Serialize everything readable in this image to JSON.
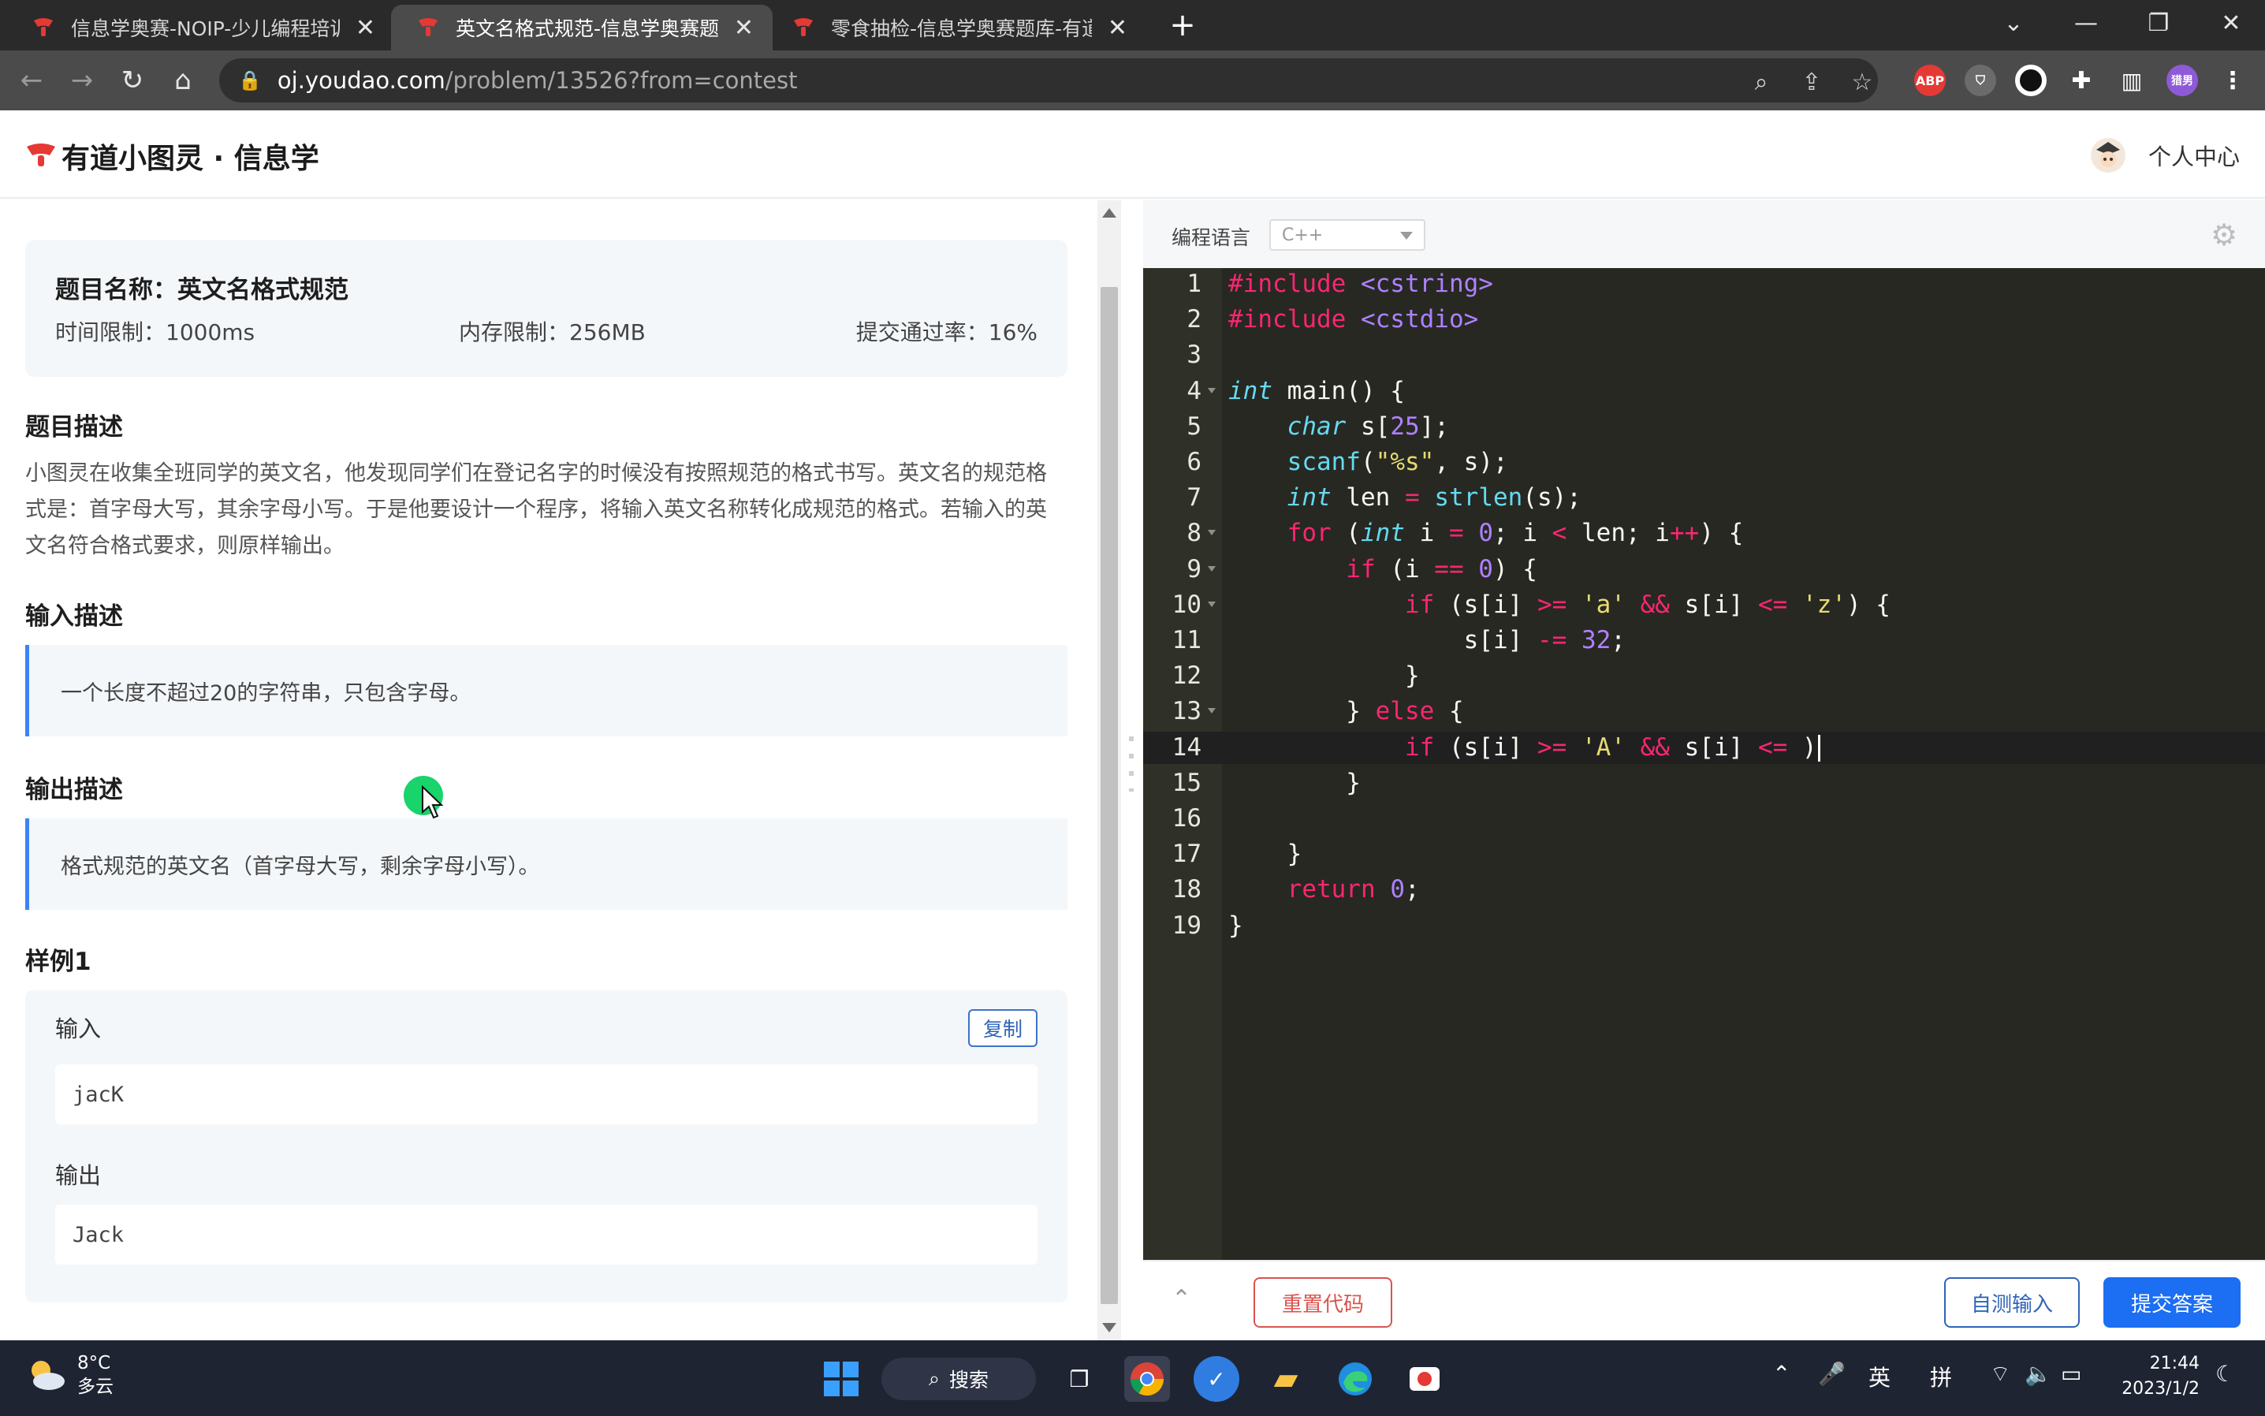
{
  "browser": {
    "tabs": [
      {
        "title": "信息学奥赛-NOIP-少儿编程培训",
        "active": false
      },
      {
        "title": "英文名格式规范-信息学奥赛题库",
        "active": true
      },
      {
        "title": "零食抽检-信息学奥赛题库-有道小",
        "active": false
      }
    ],
    "url_host": "oj.youdao.com",
    "url_path": "/problem/13526?from=contest",
    "profile_initials": "猎男",
    "ext_abp": "ABP"
  },
  "site": {
    "brand": "有道小图灵 · 信息学",
    "user_center": "个人中心"
  },
  "problem": {
    "name_label": "题目名称：英文名格式规范",
    "time_limit": "时间限制：1000ms",
    "memory_limit": "内存限制：256MB",
    "pass_rate": "提交通过率：16%",
    "desc_title": "题目描述",
    "desc_text": "小图灵在收集全班同学的英文名，他发现同学们在登记名字的时候没有按照规范的格式书写。英文名的规范格式是：首字母大写，其余字母小写。于是他要设计一个程序，将输入英文名称转化成规范的格式。若输入的英文名符合格式要求，则原样输出。",
    "input_title": "输入描述",
    "input_text": "一个长度不超过20的字符串，只包含字母。",
    "output_title": "输出描述",
    "output_text": "格式规范的英文名（首字母大写，剩余字母小写）。",
    "sample_title": "样例1",
    "sample": {
      "input_label": "输入",
      "copy_label": "复制",
      "input_value": "jacK",
      "output_label": "输出",
      "output_value": "Jack"
    }
  },
  "editor": {
    "language_label": "编程语言",
    "language_value": "C++",
    "current_line": 14,
    "lines": [
      "#include <cstring>",
      "#include <cstdio>",
      "",
      "int main() {",
      "    char s[25];",
      "    scanf(\"%s\", s);",
      "    int len = strlen(s);",
      "    for (int i = 0; i < len; i++) {",
      "        if (i == 0) {",
      "            if (s[i] >= 'a' && s[i] <= 'z') {",
      "                s[i] -= 32;",
      "            }",
      "        } else {",
      "            if (s[i] >= 'A' && s[i] <= )",
      "        }",
      "",
      "    }",
      "    return 0;",
      "}"
    ],
    "reset_label": "重置代码",
    "selftest_label": "自测输入",
    "submit_label": "提交答案"
  },
  "taskbar": {
    "weather_temp": "8°C",
    "weather_desc": "多云",
    "search_label": "搜索",
    "ime_lang": "英",
    "ime_mode": "拼",
    "time": "21:44",
    "date": "2023/1/2"
  },
  "colors": {
    "accent": "#1c6ef2",
    "danger": "#d9534f",
    "editor_bg": "#272822",
    "quote_bar": "#3b83f7"
  }
}
